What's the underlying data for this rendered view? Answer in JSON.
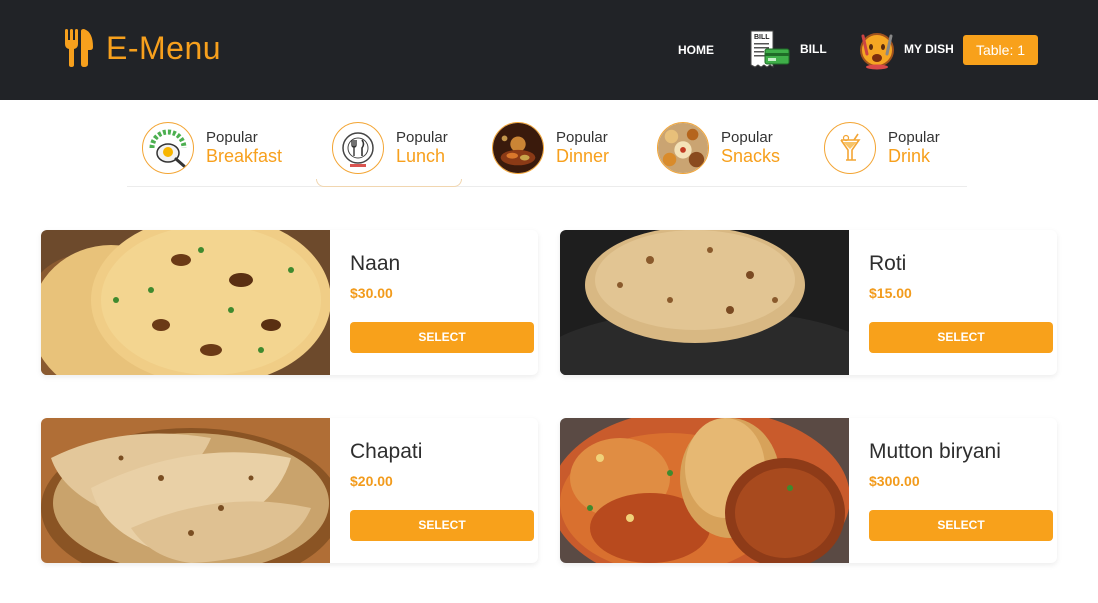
{
  "header": {
    "brand_name": "E-Menu",
    "nav": {
      "home_label": "HOME",
      "bill_label": "BILL",
      "dish_label": "MY DISH",
      "table_label": "Table: 1"
    }
  },
  "categories": [
    {
      "top": "Popular",
      "name": "Breakfast",
      "icon": "breakfast-icon",
      "active": false
    },
    {
      "top": "Popular",
      "name": "Lunch",
      "icon": "lunch-plate-icon",
      "active": true
    },
    {
      "top": "Popular",
      "name": "Dinner",
      "icon": "dinner-photo",
      "active": false
    },
    {
      "top": "Popular",
      "name": "Snacks",
      "icon": "snacks-photo",
      "active": false
    },
    {
      "top": "Popular",
      "name": "Drink",
      "icon": "drink-glass-icon",
      "active": false
    }
  ],
  "dishes": [
    {
      "name": "Naan",
      "price": "$30.00",
      "button": "SELECT",
      "image": "naan-photo"
    },
    {
      "name": "Roti",
      "price": "$15.00",
      "button": "SELECT",
      "image": "roti-photo"
    },
    {
      "name": "Chapati",
      "price": "$20.00",
      "button": "SELECT",
      "image": "chapati-photo"
    },
    {
      "name": "Mutton biryani",
      "price": "$300.00",
      "button": "SELECT",
      "image": "biryani-photo"
    }
  ],
  "colors": {
    "header_bg": "#212327",
    "accent": "#f7a01d",
    "button": "#f8a11b"
  }
}
